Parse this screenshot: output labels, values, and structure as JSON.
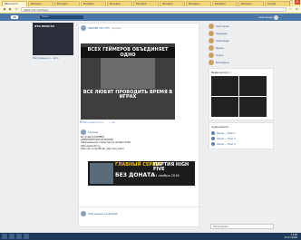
{
  "browser": {
    "tabs": [
      "ВКонтакте",
      "Вкладка",
      "Вкладка",
      "Вкладка",
      "Вкладка",
      "Вкладка",
      "Вкладка",
      "Вкладка",
      "Вкладка",
      "Вкладка",
      "Google"
    ],
    "url": "https://vk.com/feed",
    "controls": {
      "min": "–",
      "max": "□",
      "close": "✕"
    }
  },
  "vk": {
    "logo": "VK",
    "search_placeholder": "Поиск",
    "user_name": "Александр"
  },
  "left": {
    "promo_text": "ЭТО ПРОСТО",
    "promo_caption": "Популярное в ...сети"
  },
  "feed": {
    "post1": {
      "author": "СМОТРИ ЧТО ТУТ!",
      "marker": "реклама",
      "ad_top": "ВСЕХ ГЕЙМЕРОВ ОБЪЕДИНЯЕТ ОДНО",
      "ad_bottom": "ВСЕ ЛЮБЯТ ПРОВОДИТЬ ВРЕМЯ В ИГРАХ",
      "likes": "Мне нравится",
      "likes_count": "13",
      "shares": "18"
    },
    "comment": {
      "author": "Татьяна",
      "lines": [
        "Вступай в ПАРТИЮ",
        "АВТОРИТЕТНЫХ ИГРОКОВ!",
        "Официальное открытие 21 ноября 2016",
        "http://partyhf.ru/",
        "http://vk.com/official_high_five_party"
      ]
    },
    "ad2": {
      "left": "ГЛАВНЫЙ СЕРВЕР",
      "right": "ПАРТИЯ HIGH FIVE",
      "big": "БЕЗ ДОНАТА",
      "sub": "21 ноября 2016"
    },
    "post2": {
      "author": "Подслушано на форуме"
    }
  },
  "right": {
    "friends": [
      "Анастасия",
      "Надежда",
      "Александр",
      "Ирина",
      "Ольга",
      "Екатерина"
    ],
    "videos_header": "Видеозаписи",
    "videos_count": "6",
    "audio_header": "Аудиозаписи",
    "audio": [
      "Песня — Трек 1",
      "Песня — Трек 2",
      "Песня — Трек 3"
    ],
    "chat_label": "Обсуждения"
  },
  "taskbar": {
    "time": "21:09",
    "date": "14.11.2016"
  }
}
